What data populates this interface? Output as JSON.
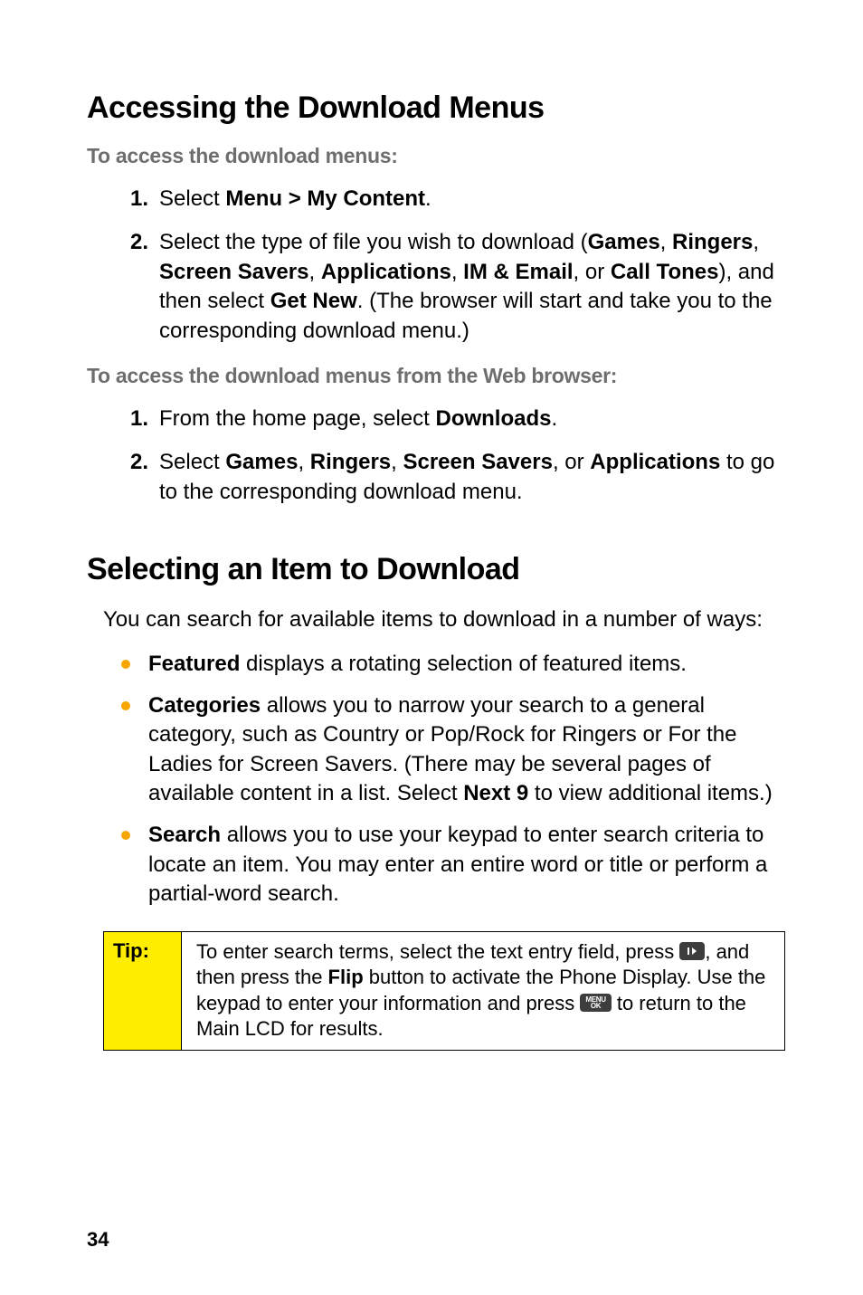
{
  "section1": {
    "title": "Accessing the Download Menus",
    "sub1": "To access the download menus:",
    "steps1": {
      "n1": "1.",
      "s1a": "Select ",
      "s1b": "Menu > My Content",
      "s1c": ".",
      "n2": "2.",
      "s2a": "Select the type of file you wish to download (",
      "s2b": "Games",
      "s2c": ", ",
      "s2d": "Ringers",
      "s2e": ", ",
      "s2f": "Screen Savers",
      "s2g": ", ",
      "s2h": "Applications",
      "s2i": ", ",
      "s2j": "IM & Email",
      "s2k": ", or ",
      "s2l": "Call Tones",
      "s2m": "), and then select ",
      "s2n": "Get New",
      "s2o": ". (The browser will start and take you to the corresponding download menu.)"
    },
    "sub2": "To access the download menus from the Web browser:",
    "steps2": {
      "n1": "1.",
      "s1a": "From the home page, select ",
      "s1b": "Downloads",
      "s1c": ".",
      "n2": "2.",
      "s2a": "Select ",
      "s2b": "Games",
      "s2c": ", ",
      "s2d": "Ringers",
      "s2e": ", ",
      "s2f": "Screen Savers",
      "s2g": ", or ",
      "s2h": "Applications",
      "s2i": " to go to the corresponding download menu."
    }
  },
  "section2": {
    "title": "Selecting an Item to Download",
    "intro": "You can search for available items to download in a number of ways:",
    "bullets": {
      "b1a": "Featured",
      "b1b": " displays a rotating selection of featured items.",
      "b2a": "Categories",
      "b2b": " allows you to narrow your search to a general category, such as Country or Pop/Rock for Ringers or For the Ladies for Screen Savers. (There may be several pages of available content in a list. Select ",
      "b2c": "Next 9",
      "b2d": " to view additional items.)",
      "b3a": "Search",
      "b3b": " allows you to use your keypad to enter search criteria to locate an item. You may enter an entire word or title or perform a partial-word search."
    }
  },
  "tip": {
    "label": "Tip:",
    "t1": "To enter search terms, select the text entry field, press ",
    "t2": ", and then press the ",
    "t3": "Flip",
    "t4": " button to activate the Phone Display. Use the keypad to enter your information and press ",
    "t5": " to return to the Main LCD for results.",
    "menu_key": "MENU\nOK"
  },
  "page_number": "34"
}
